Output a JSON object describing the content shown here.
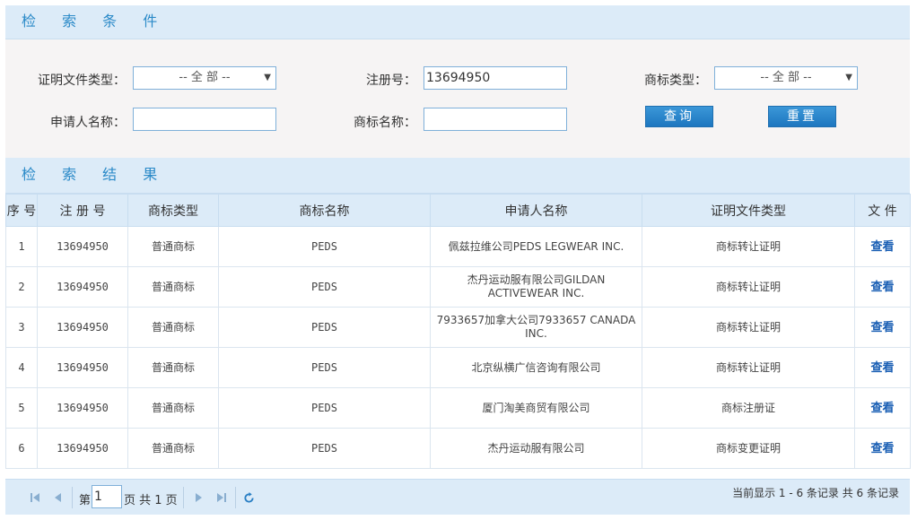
{
  "search_section": {
    "title": "检 索 条 件"
  },
  "form": {
    "cert_type_label": "证明文件类型：",
    "cert_type_value": "-- 全 部 --",
    "reg_no_label": "注册号：",
    "reg_no_value": "13694950",
    "tm_type_label": "商标类型：",
    "tm_type_value": "-- 全 部 --",
    "applicant_label": "申请人名称：",
    "applicant_value": "",
    "tm_name_label": "商标名称：",
    "tm_name_value": "",
    "query_button": "查询",
    "reset_button": "重置"
  },
  "results_section": {
    "title": "检 索 结 果"
  },
  "table": {
    "headers": [
      "序 号",
      "注 册 号",
      "商标类型",
      "商标名称",
      "申请人名称",
      "证明文件类型",
      "文 件"
    ],
    "rows": [
      [
        "1",
        "13694950",
        "普通商标",
        "PEDS",
        "佩兹拉维公司PEDS LEGWEAR INC.",
        "商标转让证明",
        "查看"
      ],
      [
        "2",
        "13694950",
        "普通商标",
        "PEDS",
        "杰丹运动服有限公司GILDAN ACTIVEWEAR INC.",
        "商标转让证明",
        "查看"
      ],
      [
        "3",
        "13694950",
        "普通商标",
        "PEDS",
        "7933657加拿大公司7933657 CANADA INC.",
        "商标转让证明",
        "查看"
      ],
      [
        "4",
        "13694950",
        "普通商标",
        "PEDS",
        "北京纵横广信咨询有限公司",
        "商标转让证明",
        "查看"
      ],
      [
        "5",
        "13694950",
        "普通商标",
        "PEDS",
        "厦门淘美商贸有限公司",
        "商标注册证",
        "查看"
      ],
      [
        "6",
        "13694950",
        "普通商标",
        "PEDS",
        "杰丹运动服有限公司",
        "商标变更证明",
        "查看"
      ]
    ]
  },
  "pager": {
    "page_prefix": "第",
    "page_value": "1",
    "page_suffix": "页 共 1 页",
    "info": "当前显示 1 - 6 条记录 共 6 条记录",
    "icons": {
      "first": "first-page-icon",
      "prev": "prev-page-icon",
      "next": "next-page-icon",
      "last": "last-page-icon",
      "refresh": "refresh-icon"
    }
  },
  "colors": {
    "header_bg": "#dcebf8",
    "title_blue": "#2b8ac8",
    "button_blue": "#1d76bf",
    "link_blue": "#1a5fb4"
  }
}
